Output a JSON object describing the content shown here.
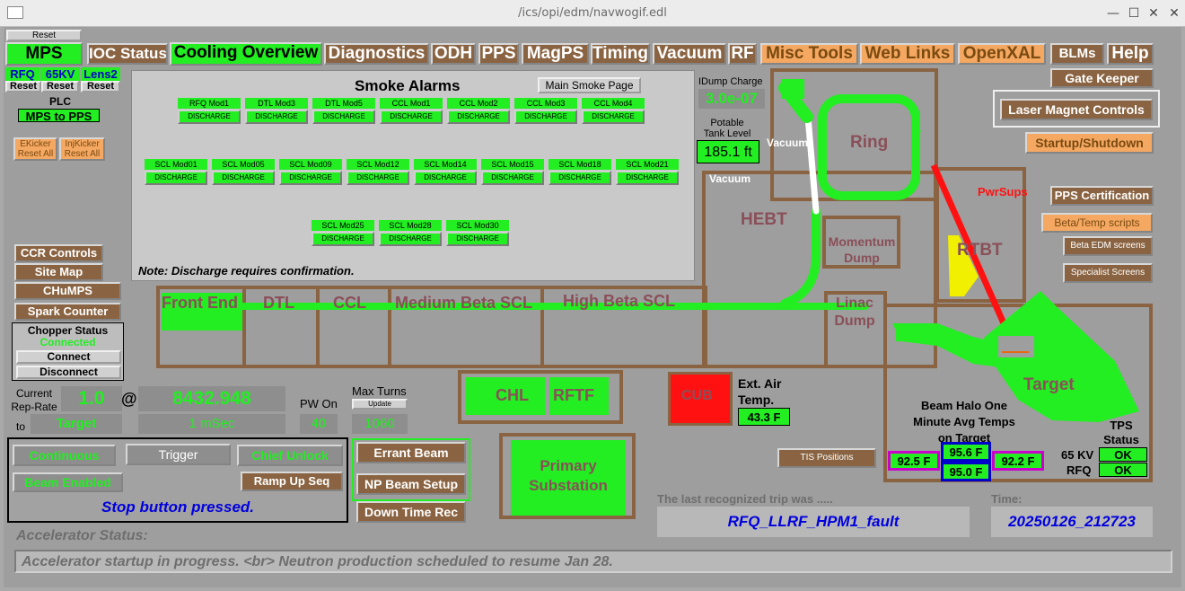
{
  "window": {
    "title": "/ics/opi/edm/navwogif.edl",
    "min": "—",
    "restore": "☐",
    "close": "✕"
  },
  "colors": {
    "green": "#22ee22",
    "brown": "#8a6442",
    "orange": "#f4a862",
    "panel": "#8e8e8e",
    "red": "#ff1111",
    "yellow": "#f0f000",
    "blue_text": "#0000dd"
  },
  "left": {
    "reset": "Reset",
    "mps": "MPS",
    "rfq": "RFQ",
    "kv65": "65KV",
    "lens2": "Lens2",
    "reset_a": "Reset",
    "reset_b": "Reset",
    "reset_c": "Reset",
    "plc": "PLC",
    "mps_to_pps": "MPS to PPS",
    "ekicker": "EKicker\nReset All",
    "injkicker": "InjKicker\nReset All",
    "ccr_controls": "CCR Controls",
    "site_map": "Site Map",
    "chumps": "CHuMPS",
    "spark_counter": "Spark Counter",
    "chopper_status": "Chopper Status",
    "chopper_state": "Connected",
    "connect": "Connect",
    "disconnect": "Disconnect"
  },
  "nav": {
    "ioc_status": "IOC Status",
    "cooling_overview": "Cooling Overview",
    "diagnostics": "Diagnostics",
    "odh": "ODH",
    "pps": "PPS",
    "magps": "MagPS",
    "timing": "Timing",
    "vacuum": "Vacuum",
    "rf": "RF",
    "misc_tools": "Misc Tools",
    "web_links": "Web Links",
    "openxal": "OpenXAL",
    "blms": "BLMs",
    "help": "Help"
  },
  "smoke": {
    "title": "Smoke Alarms",
    "main_page": "Main Smoke Page",
    "discharge": "DISCHARGE",
    "note": "Note: Discharge requires confirmation.",
    "row1": [
      "RFQ Mod1",
      "DTL Mod3",
      "DTL Mod5",
      "CCL Mod1",
      "CCL Mod2",
      "CCL Mod3",
      "CCL Mod4"
    ],
    "row2": [
      "SCL Mod01",
      "SCL Mod05",
      "SCL Mod09",
      "SCL Mod12",
      "SCL Mod14",
      "SCL Mod15",
      "SCL Mod18",
      "SCL Mod21"
    ],
    "row3": [
      "SCL Mod25",
      "SCL Mod28",
      "SCL Mod30"
    ]
  },
  "ring_area": {
    "idump_charge_label": "IDump Charge",
    "idump_charge_value": "3.0e-07",
    "potable_label": "Potable\nTank Level",
    "potable_value": "185.1 ft",
    "vacuum1": "Vacuum",
    "vacuum2": "Vacuum",
    "ring": "Ring",
    "hebt": "HEBT",
    "momentum_dump": "Momentum\nDump",
    "rtbt": "RTBT",
    "pwrsups": "PwrSups",
    "linac_dump": "Linac\nDump",
    "target": "Target"
  },
  "right": {
    "gate_keeper": "Gate Keeper",
    "laser_magnet": "Laser Magnet Controls",
    "startup_shutdown": "Startup/Shutdown",
    "pps_cert": "PPS Certification",
    "beta_temp": "Beta/Temp scripts",
    "beta_edm": "Beta EDM screens",
    "specialist": "Specialist Screens"
  },
  "linac": {
    "front_end": "Front End",
    "dtl": "DTL",
    "ccl": "CCL",
    "mbscl": "Medium Beta SCL",
    "hbscl": "High Beta SCL"
  },
  "rep": {
    "current_label": "Current\nRep-Rate",
    "to_label": "to",
    "rep_value": "1.0",
    "at": "@",
    "freq": "8432.948",
    "target": "Target",
    "pulse": "1 mSec",
    "pw_on_label": "PW On",
    "pw_on_value": "40",
    "max_turns_label": "Max Turns",
    "update": "Update",
    "max_turns_value": "1060"
  },
  "beam": {
    "continuous": "Continuous",
    "trigger": "Trigger",
    "chief_unlock": "Chief Unlock",
    "beam_enabled": "Beam Enabled",
    "ramp_up": "Ramp Up Seq",
    "stop_msg": "Stop button pressed.",
    "errant_beam": "Errant Beam",
    "np_beam_setup": "NP Beam Setup",
    "down_time_rec": "Down Time Rec"
  },
  "facility": {
    "chl": "CHL",
    "rftf": "RFTF",
    "cub": "CUB",
    "primary_sub": "Primary\nSubstation",
    "ext_air_label": "Ext. Air\nTemp.",
    "ext_air_value": "43.3 F"
  },
  "halo": {
    "title": "Beam Halo One\nMinute Avg Temps\non Target",
    "tis_positions": "TIS Positions",
    "t_left": "92.5 F",
    "t_top": "95.6 F",
    "t_bottom": "95.0 F",
    "t_right": "92.2 F",
    "tps_status": "TPS\nStatus",
    "kv65": "65 KV",
    "rfq": "RFQ",
    "ok1": "OK",
    "ok2": "OK"
  },
  "trip": {
    "label": "The last recognized trip was .....",
    "value": "RFQ_LLRF_HPM1_fault",
    "time_label": "Time:",
    "time_value": "20250126_212723"
  },
  "status": {
    "label": "Accelerator Status:",
    "message": "Accelerator startup in progress. <br> Neutron production scheduled to resume Jan 28."
  }
}
